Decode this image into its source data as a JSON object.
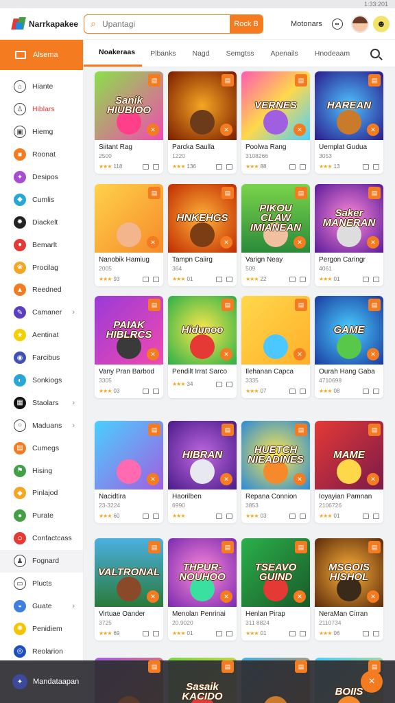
{
  "status": {
    "time": "1:33:201"
  },
  "header": {
    "logo_text": "Narrkapakee",
    "search_placeholder": "Upantagi",
    "search_button": "Rock B",
    "link": "Motonars"
  },
  "sidebar": {
    "active": "Alsema",
    "items": [
      {
        "label": "Hiante",
        "icon": "home-icon",
        "color": "#ffffff",
        "glyph": "⌂"
      },
      {
        "label": "Hiblars",
        "icon": "person-icon",
        "color": "#ffffff",
        "glyph": "♙"
      },
      {
        "label": "Hiemg",
        "icon": "image-icon",
        "color": "#ffffff",
        "glyph": "▣"
      },
      {
        "label": "Roonat",
        "icon": "square-icon",
        "color": "#f47b20",
        "glyph": "■"
      },
      {
        "label": "Desipos",
        "icon": "puzzle-icon",
        "color": "#a64dd1",
        "glyph": "✦"
      },
      {
        "label": "Cumlis",
        "icon": "cube-icon",
        "color": "#29a6d8",
        "glyph": "◆"
      },
      {
        "label": "Diackelt",
        "icon": "gear-icon",
        "color": "#222222",
        "glyph": "✹"
      },
      {
        "label": "Bemarlt",
        "icon": "leaf-icon",
        "color": "#e53935",
        "glyph": "●"
      },
      {
        "label": "Procilag",
        "icon": "paw-icon",
        "color": "#f5a623",
        "glyph": "❀"
      },
      {
        "label": "Reedned",
        "icon": "flame-icon",
        "color": "#f47b20",
        "glyph": "▲"
      },
      {
        "label": "Camaner",
        "icon": "feather-icon",
        "color": "#5c3fbf",
        "glyph": "✎",
        "chev": true
      },
      {
        "label": "Aentinat",
        "icon": "star-icon",
        "color": "#f5d000",
        "glyph": "★"
      },
      {
        "label": "Farcibus",
        "icon": "globe-icon",
        "color": "#3f51b5",
        "glyph": "◉"
      },
      {
        "label": "Sonkiogs",
        "icon": "droplet-icon",
        "color": "#29a6d8",
        "glyph": "◐"
      },
      {
        "label": "Staolars",
        "icon": "grid-icon",
        "color": "#111111",
        "glyph": "▦",
        "chev": true
      },
      {
        "label": "Maduans",
        "icon": "chat-icon",
        "color": "#ffffff",
        "glyph": "○",
        "chev": true
      },
      {
        "label": "Cumegs",
        "icon": "box-icon",
        "color": "#f47b20",
        "glyph": "▤"
      },
      {
        "label": "Hising",
        "icon": "flag-icon",
        "color": "#43a047",
        "glyph": "⚑"
      },
      {
        "label": "Pinlajod",
        "icon": "tag-icon",
        "color": "#f5a623",
        "glyph": "◆"
      },
      {
        "label": "Purate",
        "icon": "bubble-icon",
        "color": "#43a047",
        "glyph": "●"
      },
      {
        "label": "Confactcass",
        "icon": "character-icon",
        "color": "#e53935",
        "glyph": "☺"
      },
      {
        "label": "Fognard",
        "icon": "user-icon",
        "color": "#ffffff",
        "glyph": "♟",
        "sep": true
      },
      {
        "label": "Plucts",
        "icon": "document-icon",
        "color": "#ffffff",
        "glyph": "▭"
      },
      {
        "label": "Guate",
        "icon": "compass-icon",
        "color": "#3f7fe0",
        "glyph": "◒",
        "chev": true
      },
      {
        "label": "Penidiem",
        "icon": "sun-icon",
        "color": "#f5c400",
        "glyph": "✺"
      },
      {
        "label": "Reolarion",
        "icon": "refresh-icon",
        "color": "#1e4fbf",
        "glyph": "◎"
      }
    ]
  },
  "tabs": [
    "Noakeraas",
    "Plbanks",
    "Nagd",
    "Semgtss",
    "Apenails",
    "Hnodeaam"
  ],
  "games": [
    {
      "name": "Siitant Rag",
      "meta": "2500",
      "rating": "118",
      "title": "Sanik HIUBIOO",
      "bg": "linear-gradient(135deg,#8be04a,#f04ab0)",
      "char": "#ff3f8a"
    },
    {
      "name": "Parcka Saulla",
      "meta": "1220",
      "rating": "136",
      "title": "",
      "bg": "radial-gradient(circle,#f5a623,#7a1c00)",
      "char": "#6b3b1a"
    },
    {
      "name": "Poolwa Rang",
      "meta": "3108266",
      "rating": "88",
      "title": "VERNES",
      "bg": "linear-gradient(135deg,#ff5bb0,#ffd84a,#4ad0ff)",
      "char": "#a05ee0"
    },
    {
      "name": "Uemplat Gudua",
      "meta": "3053",
      "rating": "13",
      "title": "HAREAN",
      "bg": "radial-gradient(circle,#4dc3ff,#2a1a8a)",
      "char": "#c97a2a"
    },
    {
      "name": "Nanobik Hamiug",
      "meta": "2005",
      "rating": "93",
      "title": "",
      "bg": "linear-gradient(135deg,#ffd24a,#f58a2a)",
      "char": "#f2b58c"
    },
    {
      "name": "Tampn Caiirg",
      "meta": "364",
      "rating": "01",
      "title": "HNKEHGS",
      "bg": "radial-gradient(circle,#ffb23a,#c02a00)",
      "char": "#7a3d14"
    },
    {
      "name": "Varign Neay",
      "meta": "509",
      "rating": "22",
      "title": "PIKOU CLAW IMIANEAN",
      "bg": "linear-gradient(180deg,#7ad44a,#2a8a3a)",
      "char": "#f0c0a0"
    },
    {
      "name": "Pergon Caringr",
      "meta": "4061",
      "rating": "01",
      "title": "Saker MANERAN",
      "bg": "radial-gradient(circle,#ff8ad8,#5a1a9a)",
      "char": "#dddddd"
    },
    {
      "name": "Vany Pran Barbod",
      "meta": "3305",
      "rating": "03",
      "title": "PAIAK HIBLRCS",
      "bg": "linear-gradient(135deg,#9a3ad8,#f04ab0)",
      "char": "#3a3a3a"
    },
    {
      "name": "Pendilt Irrat Sarco",
      "meta": "",
      "rating": "34",
      "title": "Hidunoo",
      "bg": "radial-gradient(circle,#ffe84a,#2ab04a)",
      "char": "#e53935"
    },
    {
      "name": "Ilehanan Capca",
      "meta": "3335",
      "rating": "07",
      "title": "",
      "bg": "linear-gradient(135deg,#ffd84a,#ffaf2a)",
      "char": "#4ac8ff"
    },
    {
      "name": "Ourah Hang Gaba",
      "meta": "4710698",
      "rating": "08",
      "title": "GAME",
      "bg": "radial-gradient(circle,#4ad0ff,#1a3aa0)",
      "char": "#58c84a"
    },
    {
      "name": "Nacidtira",
      "meta": "23-3224",
      "rating": "60",
      "title": "",
      "bg": "linear-gradient(135deg,#4ad0ff,#a05ee0)",
      "char": "#ff6ab0"
    },
    {
      "name": "Haorilben",
      "meta": "6990",
      "rating": "",
      "title": "HIBRAN",
      "bg": "radial-gradient(circle,#c06ae0,#4a1a8a)",
      "char": "#e8e8f0"
    },
    {
      "name": "Repana Connion",
      "meta": "3853",
      "rating": "03",
      "title": "HUETCH NIEADINES",
      "bg": "radial-gradient(circle,#ffe84a,#2a8ad8)",
      "char": "#f58a2a"
    },
    {
      "name": "Ioyayian Pamnan",
      "meta": "2106726",
      "rating": "01",
      "title": "MAME",
      "bg": "linear-gradient(135deg,#e53935,#7a1a4a)",
      "char": "#ffd84a"
    },
    {
      "name": "Virtuae Oander",
      "meta": "3725",
      "rating": "69",
      "title": "VALTRONAL",
      "bg": "linear-gradient(180deg,#4ab0e0,#2a7a3a)",
      "char": "#8a4a2a"
    },
    {
      "name": "Menolan Penrinai",
      "meta": "20.9020",
      "rating": "01",
      "title": "THPUR- NOUHOO",
      "bg": "radial-gradient(circle,#ff8ad8,#7a2ab0)",
      "char": "#3ae0a0"
    },
    {
      "name": "Henlan Pirap",
      "meta": "311 8824",
      "rating": "01",
      "title": "TSEAVO GUIND",
      "bg": "linear-gradient(135deg,#2ab04a,#1a5a2a)",
      "char": "#e53935"
    },
    {
      "name": "NeraMan Cirran",
      "meta": "2110734",
      "rating": "06",
      "title": "MSGOIS HISHOL",
      "bg": "radial-gradient(circle,#ffb23a,#5a2a0a)",
      "char": "#3a2a1a"
    },
    {
      "name": "",
      "meta": "",
      "rating": "",
      "title": "",
      "bg": "linear-gradient(135deg,#a05ee0,#f58a2a)",
      "char": "#5a3a2a"
    },
    {
      "name": "",
      "meta": "",
      "rating": "",
      "title": "Sasaik KACIDO",
      "bg": "linear-gradient(135deg,#7ad44a,#ffd84a)",
      "char": "#e53935"
    },
    {
      "name": "",
      "meta": "",
      "rating": "",
      "title": "",
      "bg": "linear-gradient(135deg,#4ab0e0,#f58a2a)",
      "char": "#c97a2a"
    },
    {
      "name": "",
      "meta": "",
      "rating": "",
      "title": "BOIIS",
      "bg": "linear-gradient(135deg,#4ad0ff,#ffd84a)",
      "char": "#f58a2a"
    }
  ],
  "toast": {
    "text": "Mandataapan",
    "close": "×"
  }
}
